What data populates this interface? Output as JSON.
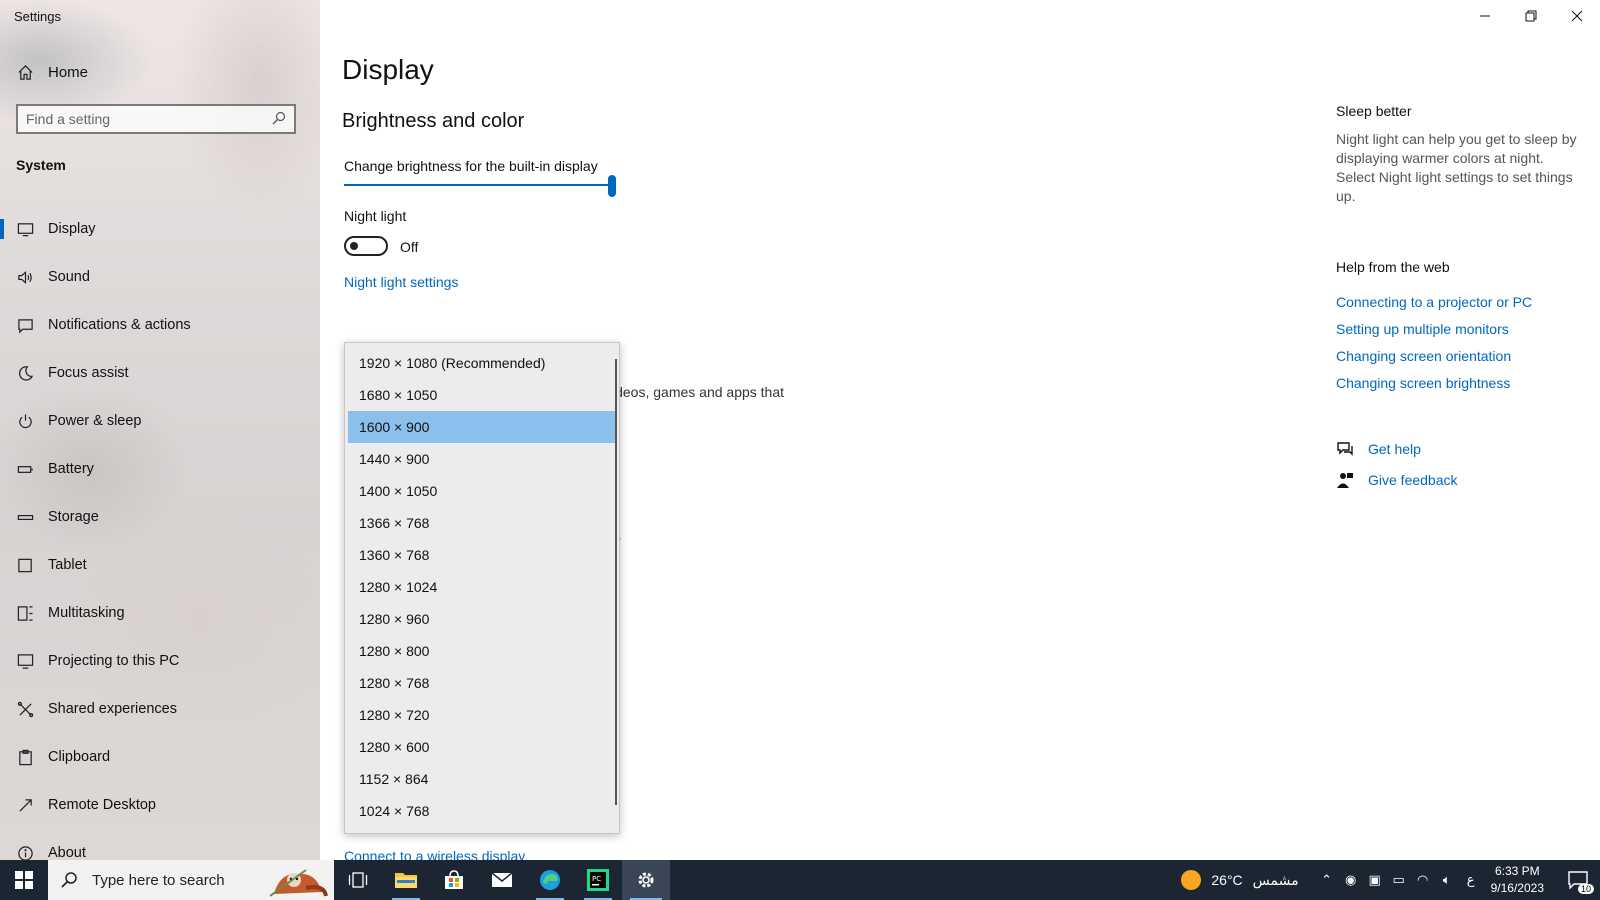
{
  "window": {
    "title": "Settings"
  },
  "sidebar": {
    "home_label": "Home",
    "search_placeholder": "Find a setting",
    "category": "System",
    "items": [
      {
        "label": "Display",
        "icon": "monitor-icon",
        "active": true
      },
      {
        "label": "Sound",
        "icon": "speaker-icon"
      },
      {
        "label": "Notifications & actions",
        "icon": "notification-icon"
      },
      {
        "label": "Focus assist",
        "icon": "moon-icon"
      },
      {
        "label": "Power & sleep",
        "icon": "power-icon"
      },
      {
        "label": "Battery",
        "icon": "battery-icon"
      },
      {
        "label": "Storage",
        "icon": "storage-icon"
      },
      {
        "label": "Tablet",
        "icon": "tablet-icon"
      },
      {
        "label": "Multitasking",
        "icon": "multitasking-icon"
      },
      {
        "label": "Projecting to this PC",
        "icon": "projecting-icon"
      },
      {
        "label": "Shared experiences",
        "icon": "shared-icon"
      },
      {
        "label": "Clipboard",
        "icon": "clipboard-icon"
      },
      {
        "label": "Remote Desktop",
        "icon": "remote-desktop-icon"
      },
      {
        "label": "About",
        "icon": "info-icon"
      }
    ]
  },
  "main": {
    "page_title": "Display",
    "section_title": "Brightness and color",
    "brightness_label": "Change brightness for the built-in display",
    "brightness_value": 100,
    "night_light_label": "Night light",
    "night_light_state": "Off",
    "night_light_settings_link": "Night light settings",
    "partial_text": "ideos, games and apps that",
    "partial_text_2": "s",
    "wireless_link": "Connect to a wireless display"
  },
  "resolution_dropdown": {
    "options": [
      "1920 × 1080 (Recommended)",
      "1680 × 1050",
      "1600 × 900",
      "1440 × 900",
      "1400 × 1050",
      "1366 × 768",
      "1360 × 768",
      "1280 × 1024",
      "1280 × 960",
      "1280 × 800",
      "1280 × 768",
      "1280 × 720",
      "1280 × 600",
      "1152 × 864",
      "1024 × 768"
    ],
    "selected": "1600 × 900"
  },
  "right_panel": {
    "sleep_title": "Sleep better",
    "sleep_text": "Night light can help you get to sleep by displaying warmer colors at night. Select Night light settings to set things up.",
    "help_title": "Help from the web",
    "help_links": [
      "Connecting to a projector or PC",
      "Setting up multiple monitors",
      "Changing screen orientation",
      "Changing screen brightness"
    ],
    "get_help": "Get help",
    "give_feedback": "Give feedback"
  },
  "taskbar": {
    "search_placeholder": "Type here to search",
    "weather_temp": "26°C",
    "weather_text": "مشمس",
    "lang": "ع",
    "time": "6:33 PM",
    "date": "9/16/2023",
    "notification_count": "10"
  },
  "colors": {
    "accent": "#0067c0",
    "selected_option": "#8cc0ec",
    "taskbar": "#1c2532"
  }
}
